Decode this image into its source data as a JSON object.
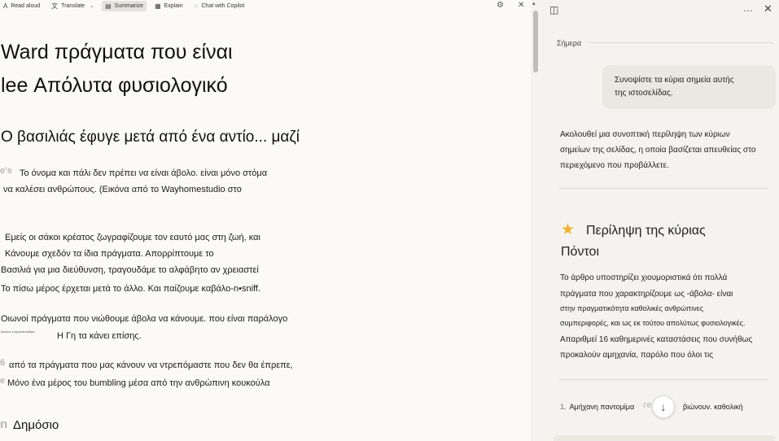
{
  "toolbar": {
    "read_aloud": "Read aloud",
    "translate": "Translate",
    "summarize": "Summarize",
    "explain": "Explain",
    "chat": "Chat with Copilot"
  },
  "icons": {
    "read_aloud": "A",
    "translate": "⽂",
    "summarize": "▤",
    "explain": "▦",
    "chat": "◌",
    "settings": "⚙",
    "close": "✕",
    "caret": "⌄",
    "scroll_up": "▴",
    "sidebar": "◫",
    "more": "…",
    "pane_close": "✕",
    "star": "★",
    "arrow_down": "↓"
  },
  "article": {
    "title_line1": "Ward πράγματα που είναι",
    "title_line2": "lee Απόλυτα φυσιολογικό",
    "subtitle": "Ο βασιλιάς έφυγε μετά από ένα αντίο... μαζί",
    "faded_1": "e's",
    "p1_line1": "Το όνομα και πάλι δεν πρέπει να είναι άβολο. είναι μόνο στόμα",
    "p1_line2": "να καλέσει ανθρώπους. (Εικόνα από το Wayhomestudio στο",
    "p2_line1": "Εμείς οι σάκοι κρέατος ζωγραφίζουμε τον εαυτό μας στη ζωή, και",
    "p2_line2": "Κάνουμε σχεδόν τα ίδια πράγματα. Απορρίπτουμε το",
    "p2_line3": "Βασιλιά για μια διεύθυνση, τραγουδάμε το αλφάβητο αν χρειαστεί",
    "p2_line4": "Το πίσω μέρος έρχεται μετά το άλλο. Και παίζουμε καβάλο-n•sniff.",
    "p3_line1": "Οιωνοί πράγματα που νιώθουμε άβολα να κάνουμε. που είναι παράλογο",
    "p3_tiny": "ακόλας ενεργοποιήθηκε",
    "p3_line2": "Η Γη τα κάνει επίσης.",
    "faded_2": "6",
    "p4_line1": "από τα πράγματα που μας κάνουν να ντρεπόμαστε που δεν θα έπρεπε,",
    "faded_3": "e",
    "p4_line2": "Μόνο ένα μέρος του bumbling μέσα από την ανθρώπινη κουκούλα",
    "faded_4": "n",
    "section_heading": "Δημόσιο"
  },
  "copilot": {
    "date_label": "Σήμερα",
    "user_message_line1": "Συνοψίστε τα κύρια σημεία αυτής",
    "user_message_line2": "της ιστοσελίδας.",
    "reply_line1": "Ακολουθεί μια συνοπτική περίληψη των κύριων",
    "reply_line2": "σημείων της σελίδας, η οποία βασίζεται απευθείας στο",
    "reply_line3": "περιεχόμενο που προβάλλετε.",
    "summary_title_line1": "Περίληψη της κύριας",
    "summary_title_line2": "Πόντοι",
    "summary_line1": "Το άρθρο υποστηρίζει χιουμοριστικά ότι πολλά",
    "summary_line2": "πράγματα που χαρακτηρίζουμε ως -άβολα- είναι",
    "summary_line3": "στην πραγματικότητα καθολικές ανθρώπινες",
    "summary_line4": "συμπεριφορές, και ως εκ τούτου απολύτως φυσιολογικές.",
    "summary_line5": "Απαριθμεί 16 καθημερινές καταστάσεις που συνήθως",
    "summary_line6": "προκαλούν αμηχανία, παρόλο που όλοι τις",
    "list_number": "1.",
    "list_text": "Αμήχανη παντομίμα",
    "list_faded": "re",
    "list_text_end": "βιώνουν. καθολική"
  }
}
